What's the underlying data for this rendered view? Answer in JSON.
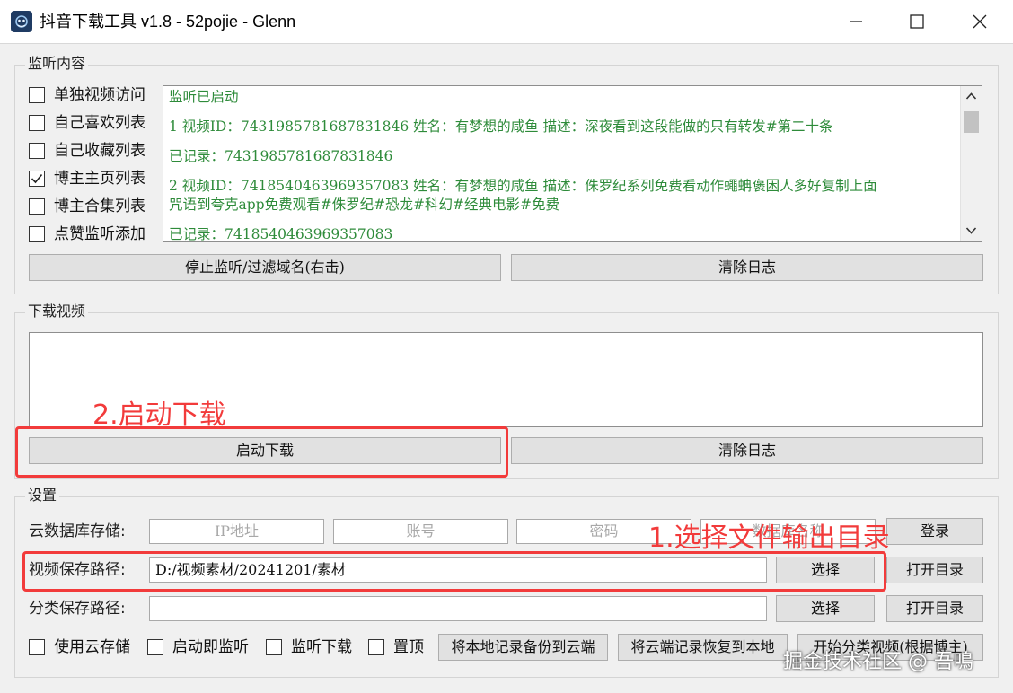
{
  "window": {
    "title": "抖音下载工具 v1.8 - 52pojie - Glenn"
  },
  "monitor": {
    "group_label": "监听内容",
    "options": [
      {
        "label": "单独视频访问",
        "checked": false
      },
      {
        "label": "自己喜欢列表",
        "checked": false
      },
      {
        "label": "自己收藏列表",
        "checked": false
      },
      {
        "label": "博主主页列表",
        "checked": true
      },
      {
        "label": "博主合集列表",
        "checked": false
      },
      {
        "label": "点赞监听添加",
        "checked": false
      }
    ],
    "log_lines": [
      "监听已启动",
      "1 视频ID：7431985781687831846 姓名：有梦想的咸鱼 描述：深夜看到这段能做的只有转发#第二十条",
      "已记录：7431985781687831846",
      "2 视频ID：7418540463969357083 姓名：有梦想的咸鱼 描述：侏罗纪系列免费看动作蠅蚺褒困人多好复制上面",
      "咒语到夸克app免费观看#侏罗纪#恐龙#科幻#经典电影#免费",
      "已记录：7418540463969357083"
    ],
    "stop_button": "停止监听/过滤域名(右击)",
    "clear_button": "清除日志"
  },
  "download": {
    "group_label": "下载视频",
    "start_button": "启动下载",
    "clear_button": "清除日志"
  },
  "settings": {
    "group_label": "设置",
    "cloud_label": "云数据库存储:",
    "ip_placeholder": "IP地址",
    "account_placeholder": "账号",
    "password_placeholder": "密码",
    "db_placeholder": "数据库名称",
    "login_button": "登录",
    "save_path_label": "视频保存路径:",
    "save_path_value": "D:/视频素材/20241201/素材",
    "select_button": "选择",
    "open_dir_button": "打开目录",
    "category_path_label": "分类保存路径:",
    "category_path_value": "",
    "category_select_button": "选择",
    "category_open_dir_button": "打开目录",
    "bottom_options": [
      {
        "label": "使用云存储",
        "checked": false
      },
      {
        "label": "启动即监听",
        "checked": false
      },
      {
        "label": "监听下载",
        "checked": false
      },
      {
        "label": "置顶",
        "checked": false
      }
    ],
    "backup_button": "将本地记录备份到云端",
    "restore_button": "将云端记录恢复到本地",
    "classify_button": "开始分类视频(根据博主)"
  },
  "annotations": {
    "step1": "1.选择文件输出目录",
    "step2": "2.启动下载",
    "color": "#f23b3b"
  },
  "watermark": "掘金技术社区 @ 吾鳴"
}
